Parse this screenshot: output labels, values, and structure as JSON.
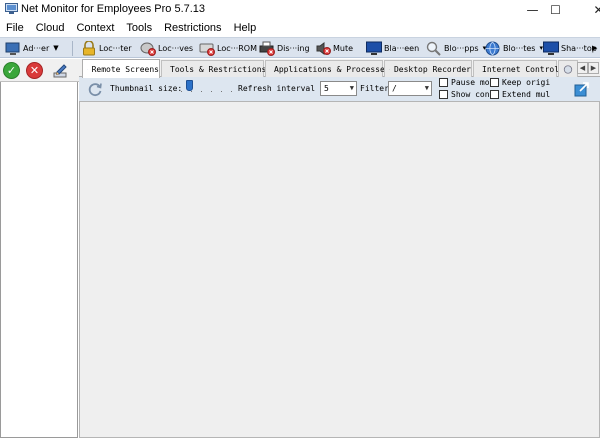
{
  "window": {
    "title": "Net Monitor for Employees Pro 5.7.13",
    "minimize_glyph": "—",
    "maximize_glyph": "☐",
    "close_glyph": "✕"
  },
  "menu": {
    "items": [
      "File",
      "Cloud",
      "Context",
      "Tools",
      "Restrictions",
      "Help"
    ]
  },
  "toolbar": {
    "buttons": [
      {
        "label": "Ad···er",
        "icon": "add-computer-icon",
        "has_dropdown": true
      },
      {
        "label": "Loc···ter",
        "icon": "lock-computer-icon"
      },
      {
        "label": "Loc···ves",
        "icon": "lock-drives-icon"
      },
      {
        "label": "Loc···ROM",
        "icon": "lock-cdrom-icon"
      },
      {
        "label": "Dis···ing",
        "icon": "disable-printing-icon"
      },
      {
        "label": "Mute",
        "icon": "mute-icon"
      },
      {
        "label": "Bla···een",
        "icon": "blank-screen-icon"
      },
      {
        "label": "Blo···pps",
        "icon": "block-apps-icon",
        "has_dropdown": true
      },
      {
        "label": "Blo···tes",
        "icon": "block-websites-icon",
        "has_dropdown": true
      },
      {
        "label": "Sha···top",
        "icon": "share-desktop-icon"
      }
    ],
    "overflow_glyph": "▶"
  },
  "left_toolbar": {
    "ok_glyph": "✓",
    "stop_glyph": "✕"
  },
  "tabs": [
    {
      "label": "Remote Screens",
      "icon": "remote-screens-icon",
      "active": true
    },
    {
      "label": "Tools & Restrictions",
      "icon": "tools-icon",
      "active": false
    },
    {
      "label": "Applications & Processes",
      "icon": "applications-icon",
      "active": false
    },
    {
      "label": "Desktop Recorder",
      "icon": "desktop-recorder-icon",
      "active": false
    },
    {
      "label": "Internet Control",
      "icon": "internet-control-icon",
      "active": false
    }
  ],
  "tab_scroll": {
    "left": "◀",
    "right": "▶"
  },
  "options": {
    "thumbnail_label": "Thumbnail size:",
    "refresh_label": "Refresh interval (s):",
    "refresh_value": "5",
    "filter_label": "Filter:",
    "filter_value": "/",
    "dropdown_glyph": "▼",
    "checkboxes": [
      {
        "label": "Pause moni",
        "checked": false
      },
      {
        "label": "Keep origi",
        "checked": false
      },
      {
        "label": "Show conne",
        "checked": false
      },
      {
        "label": "Extend mul",
        "checked": false
      }
    ]
  }
}
